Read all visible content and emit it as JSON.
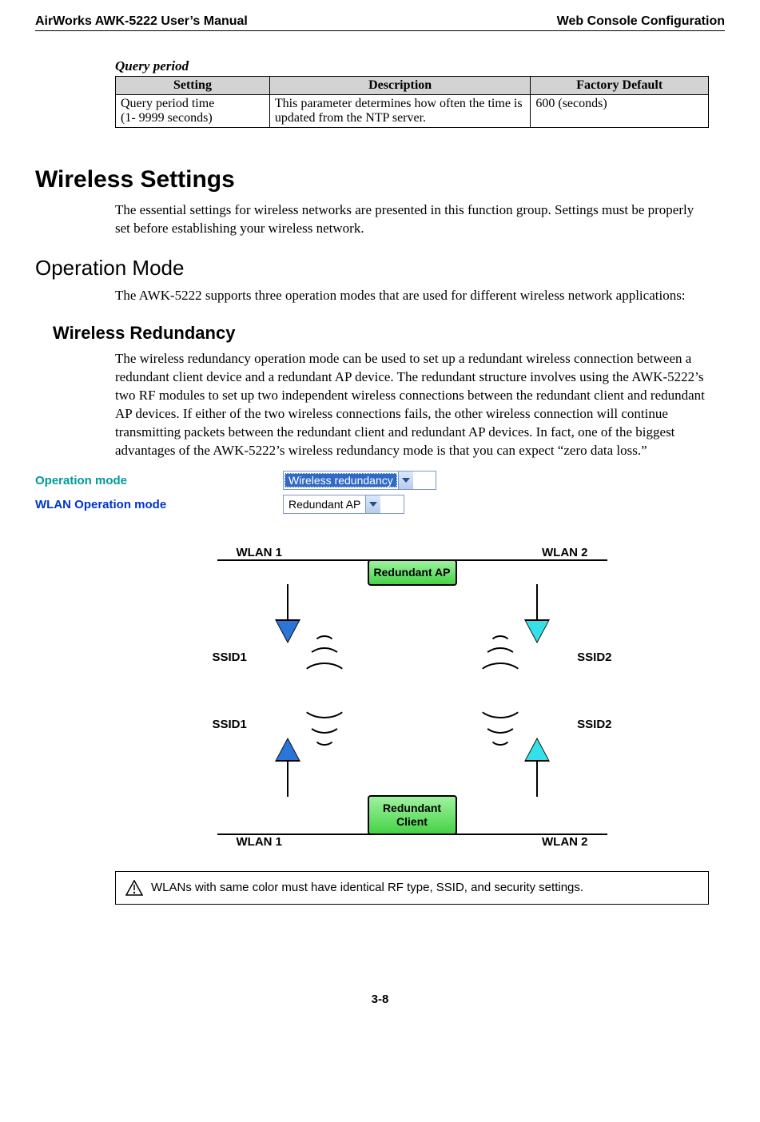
{
  "header": {
    "left": "AirWorks AWK-5222 User’s Manual",
    "right": "Web Console Configuration"
  },
  "table": {
    "caption": "Query period",
    "columns": {
      "c1": "Setting",
      "c2": "Description",
      "c3": "Factory Default"
    },
    "row": {
      "setting_line1": "Query period time",
      "setting_line2": "(1- 9999 seconds)",
      "description": "This parameter determines how often the time is updated from the NTP server.",
      "default": "600 (seconds)"
    }
  },
  "sections": {
    "wireless_settings": {
      "title": "Wireless Settings",
      "body": "The essential settings for wireless networks are presented in this function group. Settings must be properly set before establishing your wireless network."
    },
    "operation_mode": {
      "title": "Operation Mode",
      "body": "The AWK-5222 supports three operation modes that are used for different wireless network applications:"
    },
    "wireless_redundancy": {
      "title": "Wireless Redundancy",
      "body": "The wireless redundancy operation mode can be used to set up a redundant wireless connection between a redundant client device and a redundant AP device. The redundant structure involves using the AWK-5222’s two RF modules to set up two independent wireless connections between the redundant client and redundant AP devices. If either of the two wireless connections fails, the other wireless connection will continue transmitting packets between the redundant client and redundant AP devices. In fact, one of the biggest advantages of the AWK-5222’s wireless redundancy mode is that you can expect “zero data loss.”"
    }
  },
  "form": {
    "operation_mode": {
      "label": "Operation mode",
      "value": "Wireless redundancy"
    },
    "wlan_operation_mode": {
      "label": "WLAN Operation mode",
      "value": "Redundant AP"
    }
  },
  "diagram": {
    "top_wlan_left": "WLAN 1",
    "top_wlan_right": "WLAN 2",
    "ap_label": "Redundant AP",
    "ssid1": "SSID1",
    "ssid2": "SSID2",
    "client_label": "Redundant Client",
    "bottom_wlan_left": "WLAN 1",
    "bottom_wlan_right": "WLAN 2"
  },
  "note": "WLANs with same color must have identical RF type, SSID, and security settings.",
  "page_number": "3-8"
}
